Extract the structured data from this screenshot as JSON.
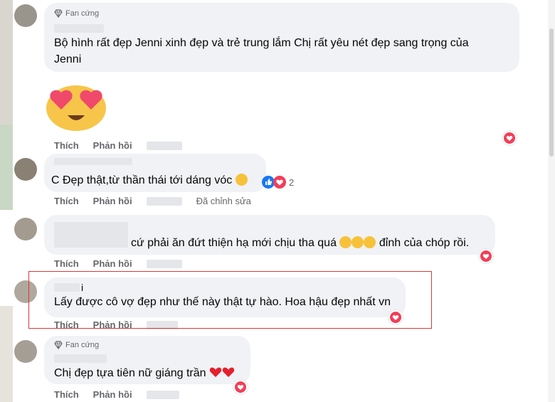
{
  "comments": [
    {
      "badge": "Fan cứng",
      "text_line1": "Bộ hình rất đẹp Jenni xinh đẹp và trẻ trung lắm Chị rất yêu nét đẹp sang trọng của",
      "text_line2": "Jenni",
      "like": "Thích",
      "reply": "Phản hồi"
    },
    {
      "text": "C Đẹp thật,từ thần thái tới dáng vóc",
      "reaction_count": "2",
      "like": "Thích",
      "reply": "Phản hồi",
      "edited": "Đã chỉnh sửa"
    },
    {
      "text": "cứ phải ăn đứt thiện hạ mới chịu tha quá",
      "text_after": "đỉnh của chóp rồi.",
      "like": "Thích",
      "reply": "Phản hồi"
    },
    {
      "name_fragment": "i",
      "text": "Lấy được cô vợ đẹp như thế này thật tự hào. Hoa hậu đẹp nhất vn",
      "like": "Thích",
      "reply": "Phản hồi"
    },
    {
      "badge": "Fan cứng",
      "text": "Chị đẹp tựa tiên nữ giáng trần",
      "like": "Thích",
      "reply": "Phản hồi"
    }
  ],
  "colors": {
    "bubble": "#f0f2f5",
    "heart": "#f33e58",
    "highlight_box": "#d63a3a"
  },
  "icons": [
    "diamond-icon",
    "heart-reaction-icon",
    "like-reaction-icon",
    "heart-eyes-emoji"
  ]
}
